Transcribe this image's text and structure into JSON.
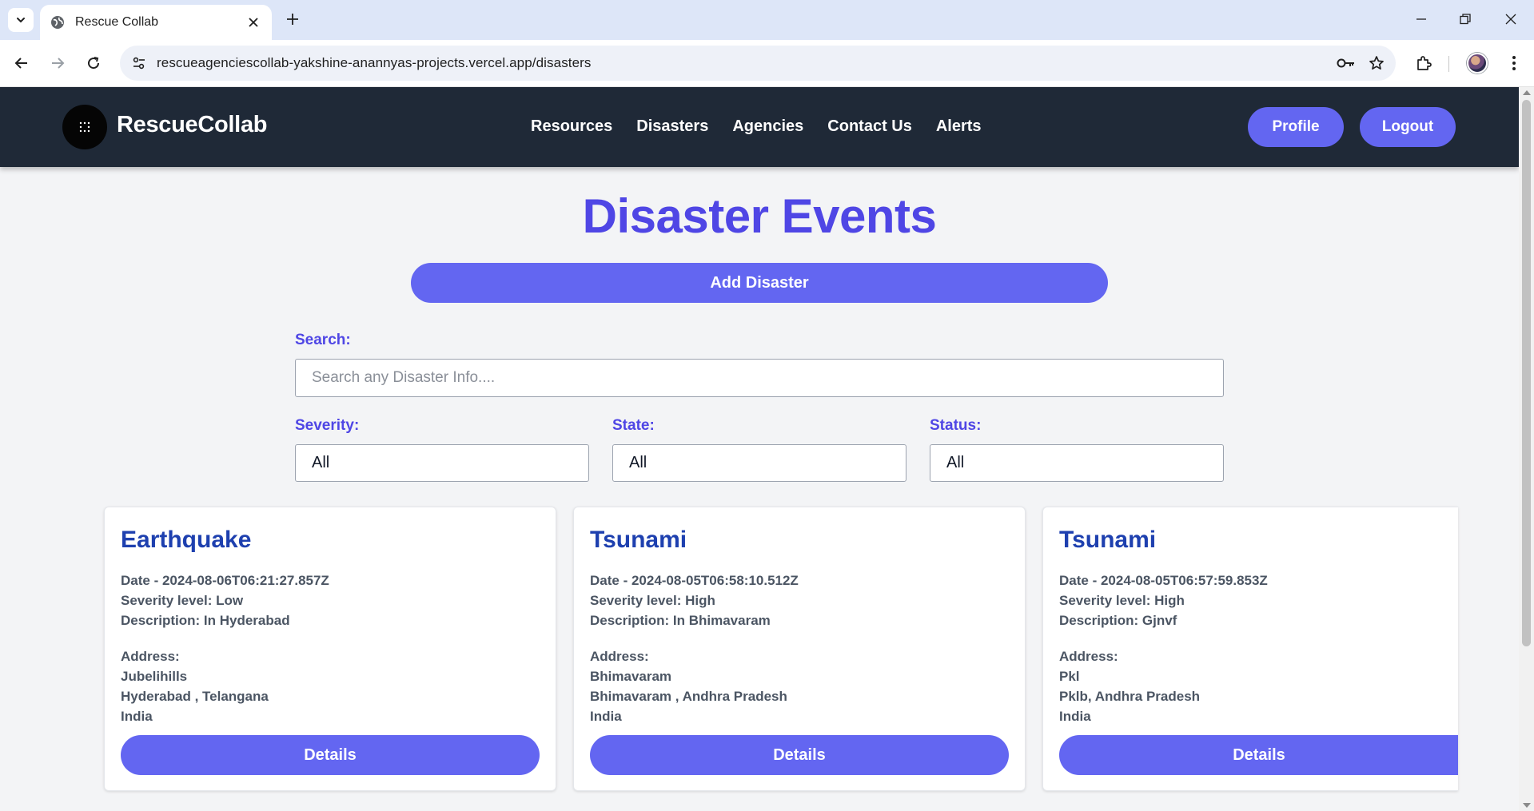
{
  "browser": {
    "tab_title": "Rescue Collab",
    "url": "rescueagenciescollab-yakshine-anannyas-projects.vercel.app/disasters"
  },
  "header": {
    "brand": "RescueCollab",
    "nav": [
      "Resources",
      "Disasters",
      "Agencies",
      "Contact Us",
      "Alerts"
    ],
    "profile_label": "Profile",
    "logout_label": "Logout"
  },
  "main": {
    "title": "Disaster Events",
    "add_button": "Add Disaster",
    "search_label": "Search:",
    "search_placeholder": "Search any Disaster Info....",
    "filters": [
      {
        "label": "Severity:",
        "value": "All"
      },
      {
        "label": "State:",
        "value": "All"
      },
      {
        "label": "Status:",
        "value": "All"
      }
    ]
  },
  "cards": [
    {
      "title": "Earthquake",
      "date": "Date - 2024-08-06T06:21:27.857Z",
      "severity": "Severity level: Low",
      "description": "Description: In Hyderabad",
      "address_label": "Address:",
      "address_line1": "Jubelihills",
      "address_line2": "Hyderabad , Telangana",
      "address_line3": "India",
      "button": "Details"
    },
    {
      "title": "Tsunami",
      "date": "Date - 2024-08-05T06:58:10.512Z",
      "severity": "Severity level: High",
      "description": "Description: In Bhimavaram",
      "address_label": "Address:",
      "address_line1": "Bhimavaram",
      "address_line2": "Bhimavaram , Andhra Pradesh",
      "address_line3": "India",
      "button": "Details"
    },
    {
      "title": "Tsunami",
      "date": "Date - 2024-08-05T06:57:59.853Z",
      "severity": "Severity level: High",
      "description": "Description: Gjnvf",
      "address_label": "Address:",
      "address_line1": "Pkl",
      "address_line2": "Pklb, Andhra Pradesh",
      "address_line3": "India",
      "button": "Details"
    }
  ],
  "colors": {
    "accent": "#6366f1",
    "title": "#4f46e5",
    "card_title": "#1e40af",
    "header_bg": "#1f2937"
  },
  "icons": {
    "tab_list": "chevron-down-icon",
    "favicon": "globe-icon",
    "tab_close": "close-icon",
    "new_tab": "plus-icon",
    "back": "arrow-left-icon",
    "forward": "arrow-right-icon",
    "reload": "reload-icon",
    "site_info": "tune-icon",
    "password": "key-icon",
    "bookmark": "star-icon",
    "extensions": "puzzle-icon",
    "menu": "kebab-menu-icon",
    "logo": "grid-dots-icon"
  }
}
